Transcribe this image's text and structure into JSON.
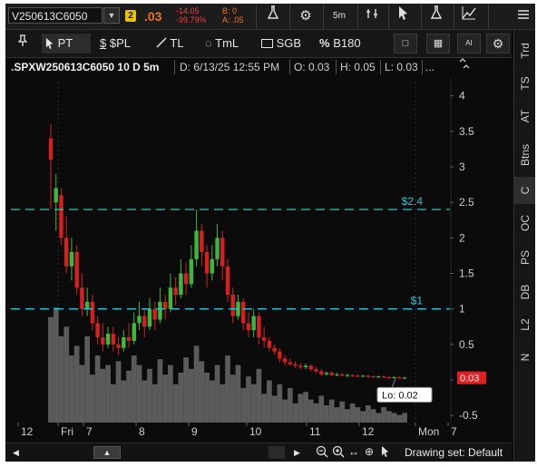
{
  "toolbar": {
    "symbol": "V250613C6050",
    "link_badge": "2",
    "last_price": ".03",
    "net_change": "-14.05",
    "pct_change": "-99.79%",
    "bid": "B: 0",
    "ask": "A: .05",
    "timeframe": "5m",
    "menu_icon": "hamburger-icon"
  },
  "drawing_tools": [
    {
      "id": "pin",
      "label": "",
      "icon": "pin-icon"
    },
    {
      "id": "pt",
      "label": "PT",
      "icon": "cursor-icon"
    },
    {
      "id": "pl",
      "label": "$PL",
      "icon": "dollar-icon"
    },
    {
      "id": "tl",
      "label": "TL",
      "icon": "trendline-icon"
    },
    {
      "id": "tml",
      "label": "TmL",
      "icon": "timeline-icon"
    },
    {
      "id": "sgb",
      "label": "SGB",
      "icon": "rectangle-icon"
    },
    {
      "id": "b180",
      "label": "B180",
      "icon": "percent-icon"
    }
  ],
  "right_tabs": [
    "Trd",
    "TS",
    "AT",
    "Btns",
    "C",
    "OC",
    "PS",
    "DB",
    "L2",
    "N"
  ],
  "active_right_tab": "C",
  "chart_header": {
    "symbol": ".SPXW250613C6050 10 D 5m",
    "date": "D: 6/13/25 12:55 PM",
    "open": "O: 0.03",
    "high": "H: 0.05",
    "low": "L: 0.03",
    "more": "..."
  },
  "price_lines": [
    {
      "label": "$2.4",
      "value": 2.4
    },
    {
      "label": "$1",
      "value": 1
    }
  ],
  "last_price_tag": "0.03",
  "low_tag": "Lo: 0.02",
  "bottom": {
    "drawing_set": "Drawing set: Default"
  },
  "chart_data": {
    "type": "candlestick",
    "title": "",
    "ylim": [
      -0.6,
      4.2
    ],
    "yticks": [
      "4",
      "3.5",
      "3",
      "2.5",
      "2",
      "1.5",
      "1",
      "0.5",
      "0",
      "-0.5"
    ],
    "xticks": [
      "12",
      "Fri",
      "7",
      "8",
      "9",
      "10",
      "11",
      "12",
      "Mon",
      "7"
    ],
    "colors": {
      "up": "#3cb83c",
      "down": "#d42020",
      "volume": "#6a6a6a",
      "lines": "#2ec4d4",
      "last_tag": "#e02020"
    },
    "candles": [
      {
        "o": 3.4,
        "c": 3.1,
        "h": 3.6,
        "l": 2.4
      },
      {
        "o": 2.5,
        "c": 2.7,
        "h": 2.9,
        "l": 2.1
      },
      {
        "o": 2.6,
        "c": 2.0,
        "h": 2.7,
        "l": 1.9
      },
      {
        "o": 2.0,
        "c": 1.6,
        "h": 2.3,
        "l": 1.5
      },
      {
        "o": 1.6,
        "c": 1.8,
        "h": 2.0,
        "l": 1.4
      },
      {
        "o": 1.8,
        "c": 1.3,
        "h": 1.9,
        "l": 1.2
      },
      {
        "o": 1.3,
        "c": 1.0,
        "h": 1.5,
        "l": 0.9
      },
      {
        "o": 1.0,
        "c": 1.1,
        "h": 1.3,
        "l": 0.9
      },
      {
        "o": 1.1,
        "c": 0.8,
        "h": 1.2,
        "l": 0.7
      },
      {
        "o": 0.8,
        "c": 0.6,
        "h": 0.9,
        "l": 0.5
      },
      {
        "o": 0.6,
        "c": 0.5,
        "h": 0.8,
        "l": 0.4
      },
      {
        "o": 0.5,
        "c": 0.65,
        "h": 0.75,
        "l": 0.45
      },
      {
        "o": 0.65,
        "c": 0.5,
        "h": 0.75,
        "l": 0.4
      },
      {
        "o": 0.5,
        "c": 0.45,
        "h": 0.6,
        "l": 0.35
      },
      {
        "o": 0.45,
        "c": 0.6,
        "h": 0.7,
        "l": 0.4
      },
      {
        "o": 0.6,
        "c": 0.55,
        "h": 0.8,
        "l": 0.45
      },
      {
        "o": 0.55,
        "c": 0.8,
        "h": 0.95,
        "l": 0.5
      },
      {
        "o": 0.8,
        "c": 0.9,
        "h": 1.1,
        "l": 0.7
      },
      {
        "o": 0.9,
        "c": 0.75,
        "h": 1.0,
        "l": 0.6
      },
      {
        "o": 0.75,
        "c": 1.0,
        "h": 1.15,
        "l": 0.7
      },
      {
        "o": 1.0,
        "c": 0.85,
        "h": 1.1,
        "l": 0.7
      },
      {
        "o": 0.85,
        "c": 1.1,
        "h": 1.3,
        "l": 0.8
      },
      {
        "o": 1.1,
        "c": 1.0,
        "h": 1.2,
        "l": 0.85
      },
      {
        "o": 1.0,
        "c": 1.3,
        "h": 1.5,
        "l": 0.95
      },
      {
        "o": 1.3,
        "c": 1.2,
        "h": 1.45,
        "l": 1.05
      },
      {
        "o": 1.2,
        "c": 1.5,
        "h": 1.7,
        "l": 1.15
      },
      {
        "o": 1.5,
        "c": 1.35,
        "h": 1.65,
        "l": 1.2
      },
      {
        "o": 1.35,
        "c": 1.7,
        "h": 1.9,
        "l": 1.3
      },
      {
        "o": 1.7,
        "c": 2.1,
        "h": 2.4,
        "l": 1.6
      },
      {
        "o": 2.1,
        "c": 1.8,
        "h": 2.2,
        "l": 1.6
      },
      {
        "o": 1.8,
        "c": 1.5,
        "h": 1.9,
        "l": 1.3
      },
      {
        "o": 1.5,
        "c": 1.7,
        "h": 1.9,
        "l": 1.4
      },
      {
        "o": 1.7,
        "c": 2.0,
        "h": 2.2,
        "l": 1.6
      },
      {
        "o": 2.0,
        "c": 1.6,
        "h": 2.1,
        "l": 1.4
      },
      {
        "o": 1.6,
        "c": 1.2,
        "h": 1.7,
        "l": 1.1
      },
      {
        "o": 1.2,
        "c": 0.9,
        "h": 1.3,
        "l": 0.8
      },
      {
        "o": 0.9,
        "c": 1.1,
        "h": 1.2,
        "l": 0.85
      },
      {
        "o": 1.1,
        "c": 0.8,
        "h": 1.15,
        "l": 0.7
      },
      {
        "o": 0.8,
        "c": 0.7,
        "h": 0.95,
        "l": 0.6
      },
      {
        "o": 0.7,
        "c": 0.9,
        "h": 1.0,
        "l": 0.6
      },
      {
        "o": 0.9,
        "c": 0.6,
        "h": 0.95,
        "l": 0.5
      },
      {
        "o": 0.6,
        "c": 0.55,
        "h": 0.75,
        "l": 0.45
      },
      {
        "o": 0.55,
        "c": 0.45,
        "h": 0.6,
        "l": 0.4
      },
      {
        "o": 0.45,
        "c": 0.4,
        "h": 0.5,
        "l": 0.35
      },
      {
        "o": 0.4,
        "c": 0.3,
        "h": 0.45,
        "l": 0.25
      },
      {
        "o": 0.3,
        "c": 0.25,
        "h": 0.35,
        "l": 0.2
      },
      {
        "o": 0.25,
        "c": 0.22,
        "h": 0.3,
        "l": 0.2
      },
      {
        "o": 0.22,
        "c": 0.2,
        "h": 0.26,
        "l": 0.17
      },
      {
        "o": 0.2,
        "c": 0.18,
        "h": 0.24,
        "l": 0.15
      },
      {
        "o": 0.18,
        "c": 0.2,
        "h": 0.23,
        "l": 0.15
      },
      {
        "o": 0.2,
        "c": 0.15,
        "h": 0.22,
        "l": 0.12
      },
      {
        "o": 0.15,
        "c": 0.12,
        "h": 0.18,
        "l": 0.1
      },
      {
        "o": 0.12,
        "c": 0.08,
        "h": 0.15,
        "l": 0.06
      },
      {
        "o": 0.08,
        "c": 0.1,
        "h": 0.12,
        "l": 0.06
      },
      {
        "o": 0.1,
        "c": 0.07,
        "h": 0.12,
        "l": 0.05
      },
      {
        "o": 0.07,
        "c": 0.08,
        "h": 0.1,
        "l": 0.05
      },
      {
        "o": 0.08,
        "c": 0.06,
        "h": 0.1,
        "l": 0.05
      },
      {
        "o": 0.06,
        "c": 0.07,
        "h": 0.09,
        "l": 0.04
      },
      {
        "o": 0.07,
        "c": 0.06,
        "h": 0.08,
        "l": 0.04
      },
      {
        "o": 0.06,
        "c": 0.05,
        "h": 0.08,
        "l": 0.04
      },
      {
        "o": 0.05,
        "c": 0.06,
        "h": 0.07,
        "l": 0.04
      },
      {
        "o": 0.06,
        "c": 0.05,
        "h": 0.07,
        "l": 0.03
      },
      {
        "o": 0.05,
        "c": 0.04,
        "h": 0.06,
        "l": 0.03
      },
      {
        "o": 0.04,
        "c": 0.05,
        "h": 0.06,
        "l": 0.03
      },
      {
        "o": 0.05,
        "c": 0.04,
        "h": 0.06,
        "l": 0.02
      },
      {
        "o": 0.04,
        "c": 0.03,
        "h": 0.05,
        "l": 0.02
      },
      {
        "o": 0.03,
        "c": 0.04,
        "h": 0.05,
        "l": 0.02
      },
      {
        "o": 0.04,
        "c": 0.03,
        "h": 0.05,
        "l": 0.02
      },
      {
        "o": 0.03,
        "c": 0.03,
        "h": 0.05,
        "l": 0.02
      }
    ],
    "volume": [
      0.55,
      0.6,
      0.45,
      0.5,
      0.35,
      0.4,
      0.3,
      0.45,
      0.25,
      0.35,
      0.28,
      0.3,
      0.2,
      0.32,
      0.22,
      0.27,
      0.35,
      0.3,
      0.22,
      0.28,
      0.2,
      0.33,
      0.25,
      0.3,
      0.2,
      0.26,
      0.34,
      0.28,
      0.4,
      0.32,
      0.26,
      0.22,
      0.3,
      0.2,
      0.35,
      0.25,
      0.3,
      0.18,
      0.24,
      0.2,
      0.28,
      0.15,
      0.22,
      0.14,
      0.2,
      0.12,
      0.18,
      0.1,
      0.15,
      0.16,
      0.12,
      0.1,
      0.14,
      0.09,
      0.12,
      0.08,
      0.11,
      0.07,
      0.1,
      0.08,
      0.06,
      0.09,
      0.07,
      0.05,
      0.08,
      0.06,
      0.05,
      0.04,
      0.05
    ]
  }
}
